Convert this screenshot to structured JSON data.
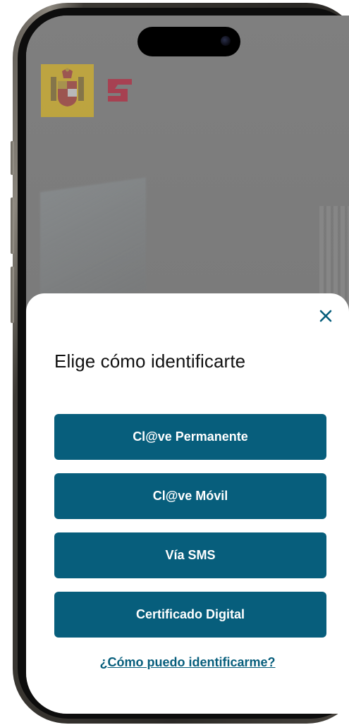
{
  "sheet": {
    "title": "Elige cómo identificarte",
    "close_icon": "close-icon",
    "options": [
      {
        "label": "Cl@ve Permanente"
      },
      {
        "label": "Cl@ve Móvil"
      },
      {
        "label": "Vía SMS"
      },
      {
        "label": "Certificado Digital"
      }
    ],
    "help_link": "¿Cómo puedo identificarme?"
  },
  "header": {
    "logos": [
      "spain-coat-of-arms-icon",
      "seguridad-social-logo-icon"
    ]
  },
  "colors": {
    "primary": "#075e7c",
    "sheet_background": "#ffffff",
    "overlay": "#7d7d7d",
    "title_text": "#111111"
  }
}
